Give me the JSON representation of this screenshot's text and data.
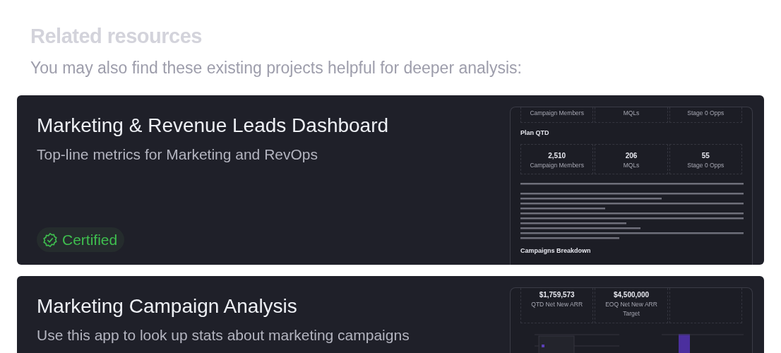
{
  "heading": "Related resources",
  "subheading": "You may also find these existing projects helpful for deeper analysis:",
  "resources": [
    {
      "title": "Marketing & Revenue Leads Dashboard",
      "description": "Top-line metrics for Marketing and RevOps",
      "badge": "Certified",
      "preview": [
        {
          "kind": "metrics",
          "items": [
            {
              "label": "Campaign Members"
            },
            {
              "label": "MQLs"
            },
            {
              "label": "Stage 0 Opps"
            }
          ]
        },
        {
          "kind": "heading",
          "text": "Plan QTD"
        },
        {
          "kind": "metrics",
          "items": [
            {
              "value": "2,510",
              "label": "Campaign Members"
            },
            {
              "value": "206",
              "label": "MQLs"
            },
            {
              "value": "55",
              "label": "Stage 0 Opps"
            }
          ]
        },
        {
          "kind": "lines"
        },
        {
          "kind": "heading",
          "text": "Campaigns Breakdown"
        }
      ]
    },
    {
      "title": "Marketing Campaign Analysis",
      "description": "Use this app to look up stats about marketing campaigns",
      "preview": [
        {
          "kind": "metrics",
          "items": [
            {
              "value": "$1,759,573",
              "label": "QTD Net New ARR"
            },
            {
              "value": "$4,500,000",
              "label": "EOQ Net New ARR Target"
            }
          ]
        },
        {
          "kind": "chart"
        }
      ]
    }
  ]
}
